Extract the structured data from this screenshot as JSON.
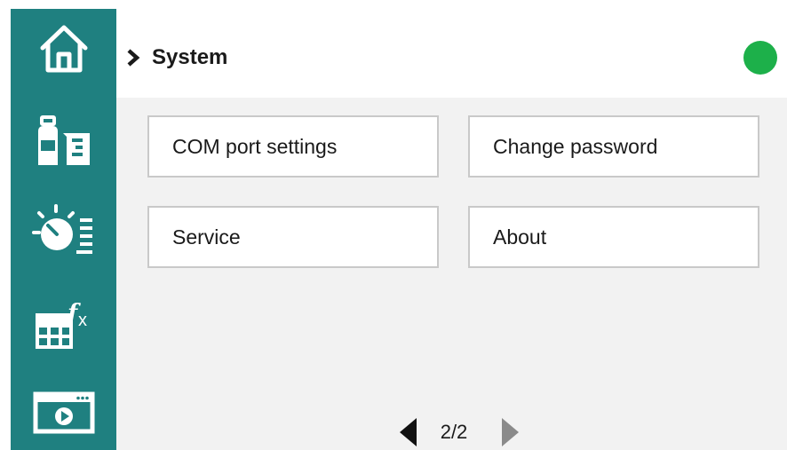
{
  "header": {
    "title": "System",
    "status_color": "#1db04a"
  },
  "sidebar": {
    "color": "#1f8080",
    "items": [
      {
        "icon": "home-icon"
      },
      {
        "icon": "bottle-beaker-icon"
      },
      {
        "icon": "timer-settings-icon"
      },
      {
        "icon": "table-formula-icon"
      },
      {
        "icon": "video-player-icon"
      }
    ]
  },
  "tiles": [
    {
      "label": "COM port settings"
    },
    {
      "label": "Change password"
    },
    {
      "label": "Service"
    },
    {
      "label": "About"
    }
  ],
  "pager": {
    "text": "2/2",
    "prev_icon": "caret-left-icon",
    "next_icon": "caret-right-icon",
    "next_enabled": false
  }
}
